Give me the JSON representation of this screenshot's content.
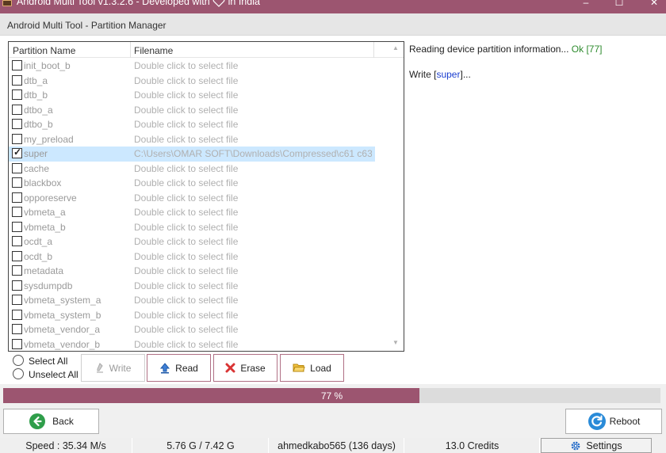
{
  "window": {
    "title_before": "Android Multi Tool v1.3.2.6 - Developed with",
    "title_after": "in India",
    "subtitle": "Android Multi Tool - Partition Manager",
    "min": "–",
    "max": "☐",
    "close": "✕"
  },
  "table": {
    "headers": {
      "name": "Partition Name",
      "file": "Filename"
    },
    "rows": [
      {
        "name": "init_boot_b",
        "file": "Double click to select file",
        "checked": false
      },
      {
        "name": "dtb_a",
        "file": "Double click to select file",
        "checked": false
      },
      {
        "name": "dtb_b",
        "file": "Double click to select file",
        "checked": false
      },
      {
        "name": "dtbo_a",
        "file": "Double click to select file",
        "checked": false
      },
      {
        "name": "dtbo_b",
        "file": "Double click to select file",
        "checked": false
      },
      {
        "name": "my_preload",
        "file": "Double click to select file",
        "checked": false
      },
      {
        "name": "super",
        "file": "C:\\Users\\OMAR SOFT\\Downloads\\Compressed\\c61 c63  ...",
        "checked": true
      },
      {
        "name": "cache",
        "file": "Double click to select file",
        "checked": false
      },
      {
        "name": "blackbox",
        "file": "Double click to select file",
        "checked": false
      },
      {
        "name": "opporeserve",
        "file": "Double click to select file",
        "checked": false
      },
      {
        "name": "vbmeta_a",
        "file": "Double click to select file",
        "checked": false
      },
      {
        "name": "vbmeta_b",
        "file": "Double click to select file",
        "checked": false
      },
      {
        "name": "ocdt_a",
        "file": "Double click to select file",
        "checked": false
      },
      {
        "name": "ocdt_b",
        "file": "Double click to select file",
        "checked": false
      },
      {
        "name": "metadata",
        "file": "Double click to select file",
        "checked": false
      },
      {
        "name": "sysdumpdb",
        "file": "Double click to select file",
        "checked": false
      },
      {
        "name": "vbmeta_system_a",
        "file": "Double click to select file",
        "checked": false
      },
      {
        "name": "vbmeta_system_b",
        "file": "Double click to select file",
        "checked": false
      },
      {
        "name": "vbmeta_vendor_a",
        "file": "Double click to select file",
        "checked": false
      },
      {
        "name": "vbmeta_vendor_b",
        "file": "Double click to select file",
        "checked": false
      }
    ]
  },
  "log": {
    "line1_text": "Reading device partition information... ",
    "line1_status": "Ok [77]",
    "line2_prefix": "Write [",
    "line2_target": "super",
    "line2_suffix": "]..."
  },
  "options": {
    "select_all": "Select All",
    "unselect_all": "Unselect All"
  },
  "actions": {
    "write": "Write",
    "read": "Read",
    "erase": "Erase",
    "load": "Load"
  },
  "progress": {
    "percent": 77,
    "label": "77 %"
  },
  "nav": {
    "back": "Back",
    "reboot": "Reboot"
  },
  "statusbar": {
    "speed": "Speed : 35.34 M/s",
    "size": "5.76 G / 7.42 G",
    "user": "ahmedkabo565 (136 days)",
    "credits": "13.0 Credits",
    "settings": "Settings"
  },
  "colors": {
    "accent": "#9c5570",
    "ok": "#2e8b2e",
    "link": "#1c3fd0"
  }
}
